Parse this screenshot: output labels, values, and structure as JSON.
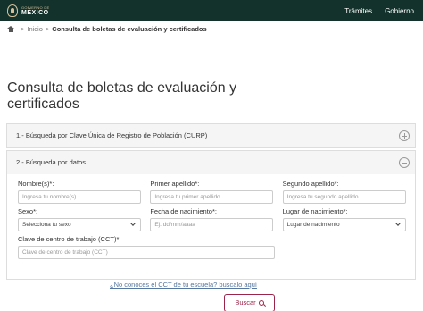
{
  "header": {
    "logo_small": "GOBIERNO DE",
    "logo_big": "MÉXICO",
    "nav": [
      "Trámites",
      "Gobierno"
    ]
  },
  "breadcrumb": {
    "sep": ">",
    "home_link": "Inicio",
    "current": "Consulta de boletas de evaluación y certificados"
  },
  "page_title": "Consulta de boletas de evaluación y certificados",
  "panels": [
    {
      "label": "1.- Búsqueda por Clave Única de Registro de Población (CURP)",
      "state": "collapsed"
    },
    {
      "label": "2.- Búsqueda por datos",
      "state": "expanded"
    }
  ],
  "form": {
    "nombres": {
      "label": "Nombre(s)*:",
      "placeholder": "Ingresa tu nombre(s)"
    },
    "primer_apellido": {
      "label": "Primer apellido*:",
      "placeholder": "Ingresa tu primer apellido"
    },
    "segundo_apellido": {
      "label": "Segundo apellido*:",
      "placeholder": "Ingresa tu segundo apellido"
    },
    "sexo": {
      "label": "Sexo*:",
      "value": "Selecciona tu sexo"
    },
    "fecha_nacimiento": {
      "label": "Fecha de nacimiento*:",
      "placeholder": "Ej. dd/mm/aaaa"
    },
    "lugar_nacimiento": {
      "label": "Lugar de nacimiento*:",
      "value": "Lugar de nacimiento"
    },
    "cct": {
      "label": "Clave de centro de trabajo (CCT)*:",
      "placeholder": "Clave de centro de trabajo (CCT)"
    },
    "cct_link": "¿No conoces el CCT de tu escuela? buscalo aquí",
    "search_button": "Buscar"
  },
  "colors": {
    "header_bg": "#13322b",
    "accent": "#9d2449",
    "link": "#5678a0"
  }
}
